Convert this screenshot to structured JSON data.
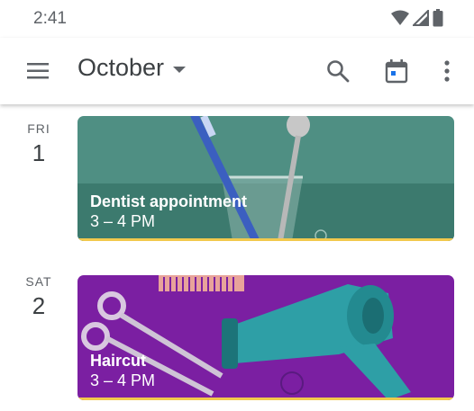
{
  "status_bar": {
    "time": "2:41",
    "icons": [
      "wifi-icon",
      "signal-icon",
      "battery-icon"
    ]
  },
  "app_bar": {
    "month": "October",
    "icons": [
      "menu-icon",
      "dropdown-caret-icon",
      "search-icon",
      "today-calendar-icon",
      "more-vert-icon"
    ]
  },
  "days": [
    {
      "dow": "FRI",
      "date": "1",
      "event": {
        "title": "Dentist appointment",
        "time": "3 – 4 PM",
        "color": "#3f8074",
        "accent": "#f2c94c",
        "illustration": "toothbrush-cup"
      }
    },
    {
      "dow": "SAT",
      "date": "2",
      "event": {
        "title": "Haircut",
        "time": "3 – 4 PM",
        "color": "#7b1fa2",
        "accent": "#f2c94c",
        "illustration": "hairdryer-scissors-comb"
      }
    }
  ],
  "colors": {
    "text_primary": "#3c4043",
    "text_secondary": "#5f6368",
    "accent_blue": "#1a73e8"
  }
}
